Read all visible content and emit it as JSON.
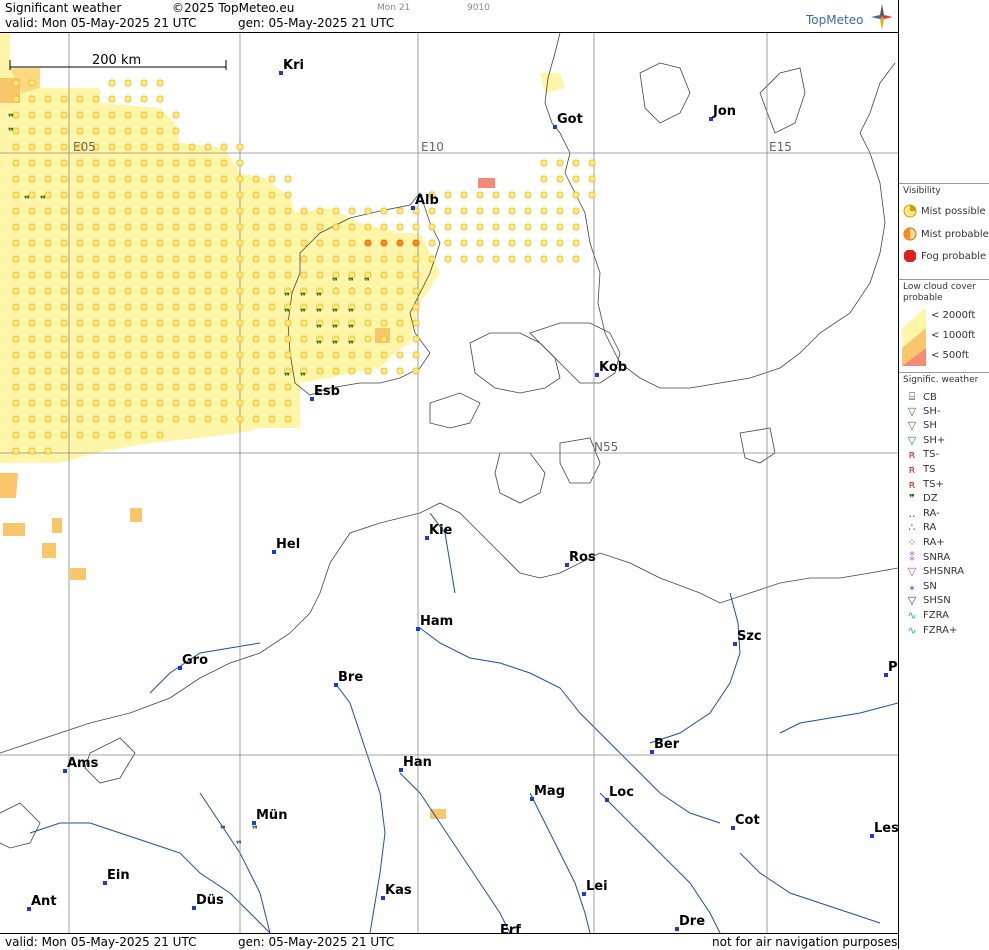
{
  "header": {
    "title": "Significant weather",
    "copyright": "©2025 TopMeteo.eu",
    "valid": "valid:  Mon  05-May-2025  21 UTC",
    "generated": "gen: 05-May-2025 21 UTC",
    "day_code": "Mon 21",
    "run_code": "9010",
    "brand": "TopMeteo"
  },
  "footer": {
    "valid": "valid:  Mon  05-May-2025  21 UTC",
    "generated": "gen: 05-May-2025 21 UTC",
    "disclaimer": "not for air navigation purposes"
  },
  "map": {
    "scale_label": "200 km",
    "grid_labels": [
      "E05",
      "E10",
      "E15",
      "N55"
    ],
    "cities": [
      {
        "name": "Kri"
      },
      {
        "name": "Got"
      },
      {
        "name": "Jon"
      },
      {
        "name": "Alb"
      },
      {
        "name": "Kob"
      },
      {
        "name": "Esb"
      },
      {
        "name": "Kie"
      },
      {
        "name": "Hel"
      },
      {
        "name": "Ros"
      },
      {
        "name": "Ham"
      },
      {
        "name": "Szc"
      },
      {
        "name": "Gro"
      },
      {
        "name": "Bre"
      },
      {
        "name": "P"
      },
      {
        "name": "Ams"
      },
      {
        "name": "Han"
      },
      {
        "name": "Ber"
      },
      {
        "name": "Mag"
      },
      {
        "name": "Loc"
      },
      {
        "name": "Mün"
      },
      {
        "name": "Cot"
      },
      {
        "name": "Les"
      },
      {
        "name": "Ein"
      },
      {
        "name": "Kas"
      },
      {
        "name": "Lei"
      },
      {
        "name": "Ant"
      },
      {
        "name": "Düs"
      },
      {
        "name": "Dre"
      },
      {
        "name": "Erf"
      }
    ]
  },
  "legend": {
    "visibility": {
      "title": "Visibility",
      "items": [
        "Mist possible",
        "Mist probable",
        "Fog probable"
      ],
      "colors": [
        "#ffe680",
        "#ff8c1a",
        "#e0201a"
      ]
    },
    "low_cloud": {
      "title_line1": "Low cloud cover",
      "title_line2": "probable",
      "items": [
        "< 2000ft",
        "< 1000ft",
        "<   500ft"
      ],
      "colors": [
        "#fff5a8",
        "#f9c66b",
        "#f78a76"
      ]
    },
    "signif": {
      "title": "Signific. weather",
      "items": [
        "CB",
        "SH-",
        "SH",
        "SH+",
        "TS-",
        "TS",
        "TS+",
        "DZ",
        "RA-",
        "RA",
        "RA+",
        "SNRA",
        "SHSNRA",
        "SN",
        "SHSN",
        "FZRA",
        "FZRA+"
      ]
    }
  }
}
